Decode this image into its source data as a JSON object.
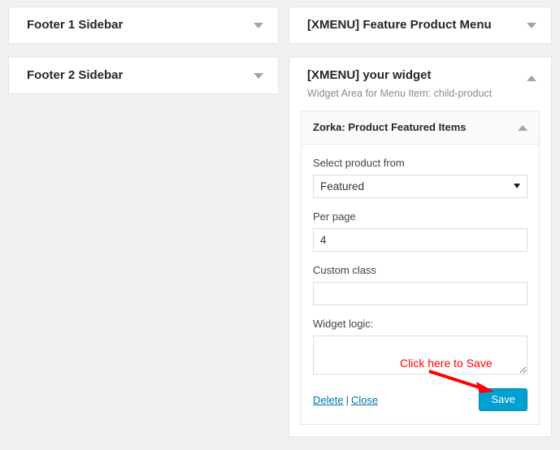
{
  "colors": {
    "page_background": "#f1f1f1",
    "panel_background": "#ffffff",
    "panel_border": "#e5e5e5",
    "widget_head_background": "#fafafa",
    "link_blue": "#0073aa",
    "save_button_background": "#00a0d2",
    "save_button_border": "#0085ba",
    "annotation_red": "#ff0000",
    "toggle_arrow_gray": "#a0a5aa",
    "label_text": "#444444",
    "description_text": "#868c91"
  },
  "left_column": {
    "panels": [
      {
        "title": "Footer 1 Sidebar",
        "toggle_icon": "chevron-down-icon",
        "expanded": false
      },
      {
        "title": "Footer 2 Sidebar",
        "toggle_icon": "chevron-down-icon",
        "expanded": false
      }
    ]
  },
  "right_column": {
    "panels": [
      {
        "title": "[XMENU] Feature Product Menu",
        "toggle_icon": "chevron-down-icon",
        "expanded": false
      },
      {
        "title": "[XMENU] your widget",
        "description": "Widget Area for Menu Item: child-product",
        "toggle_icon": "chevron-up-icon",
        "expanded": true
      }
    ]
  },
  "widget": {
    "title": "Zorka: Product Featured Items",
    "toggle_icon": "chevron-up-icon",
    "expanded": true,
    "fields": [
      {
        "name": "select-product-from",
        "label": "Select product from",
        "type": "select",
        "value": "Featured",
        "options": [
          "Featured"
        ],
        "caret_icon": "caret-down-icon"
      },
      {
        "name": "per-page",
        "label": "Per page",
        "type": "text",
        "value": "4",
        "placeholder": ""
      },
      {
        "name": "custom-class",
        "label": "Custom class",
        "type": "text",
        "value": "",
        "placeholder": ""
      },
      {
        "name": "widget-logic",
        "label": "Widget logic:",
        "type": "textarea",
        "value": "",
        "placeholder": ""
      }
    ],
    "actions": {
      "delete_label": "Delete",
      "separator": "|",
      "close_label": "Close",
      "save_label": "Save"
    }
  },
  "annotation": {
    "text": "Click here to Save",
    "arrow_icon": "arrow-pointing-right-down-icon",
    "color": "#ff0000"
  }
}
